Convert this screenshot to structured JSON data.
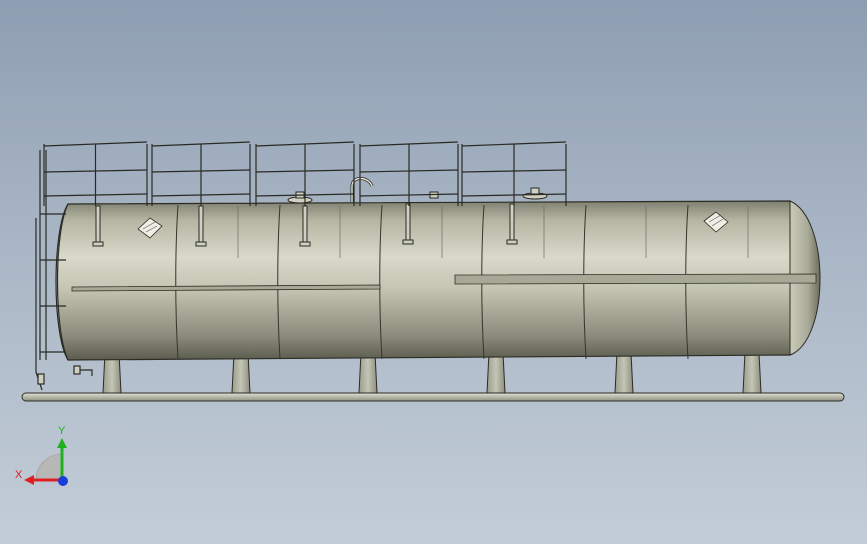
{
  "viewport": {
    "background_top": "#8e9eb2",
    "background_bottom": "#c3cdd8",
    "model": "horizontal-storage-tank-assembly"
  },
  "triad": {
    "x_label": "X",
    "y_label": "Y",
    "x_color": "#e02020",
    "y_color": "#20b020",
    "z_color": "#1a3ed8"
  }
}
